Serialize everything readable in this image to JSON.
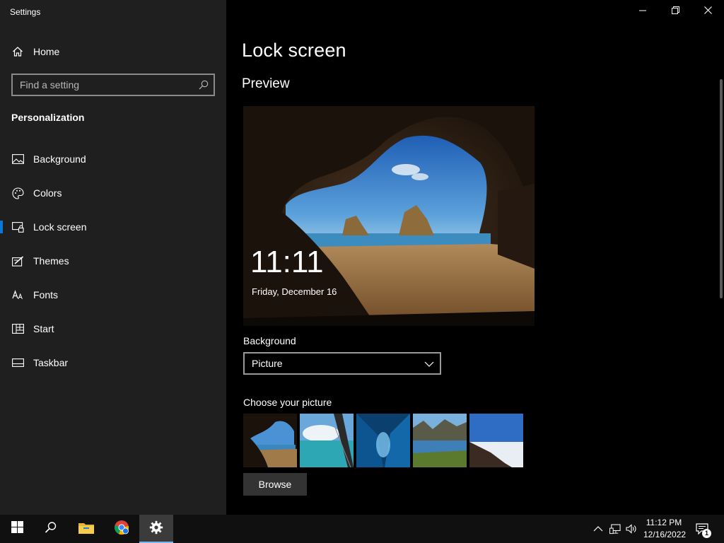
{
  "window": {
    "title": "Settings",
    "controls": {
      "minimize": "minimize-icon",
      "restore": "restore-icon",
      "close": "close-icon"
    }
  },
  "sidebar": {
    "home_label": "Home",
    "search": {
      "placeholder": "Find a setting",
      "value": ""
    },
    "section": "Personalization",
    "items": [
      {
        "label": "Background",
        "icon": "picture-icon",
        "active": false
      },
      {
        "label": "Colors",
        "icon": "palette-icon",
        "active": false
      },
      {
        "label": "Lock screen",
        "icon": "lock-screen-icon",
        "active": true
      },
      {
        "label": "Themes",
        "icon": "themes-icon",
        "active": false
      },
      {
        "label": "Fonts",
        "icon": "fonts-icon",
        "active": false
      },
      {
        "label": "Start",
        "icon": "start-icon",
        "active": false
      },
      {
        "label": "Taskbar",
        "icon": "taskbar-icon",
        "active": false
      }
    ]
  },
  "main": {
    "title": "Lock screen",
    "preview_heading": "Preview",
    "preview": {
      "time": "11:11",
      "date": "Friday, December 16"
    },
    "background_label": "Background",
    "background_value": "Picture",
    "choose_label": "Choose your picture",
    "browse_label": "Browse"
  },
  "taskbar": {
    "clock_time": "11:12 PM",
    "clock_date": "12/16/2022",
    "notification_count": "1"
  },
  "colors": {
    "accent": "#0a78d7",
    "sidebar_bg": "#1f1f1f",
    "main_bg": "#000000",
    "taskbar_bg": "#101010"
  }
}
